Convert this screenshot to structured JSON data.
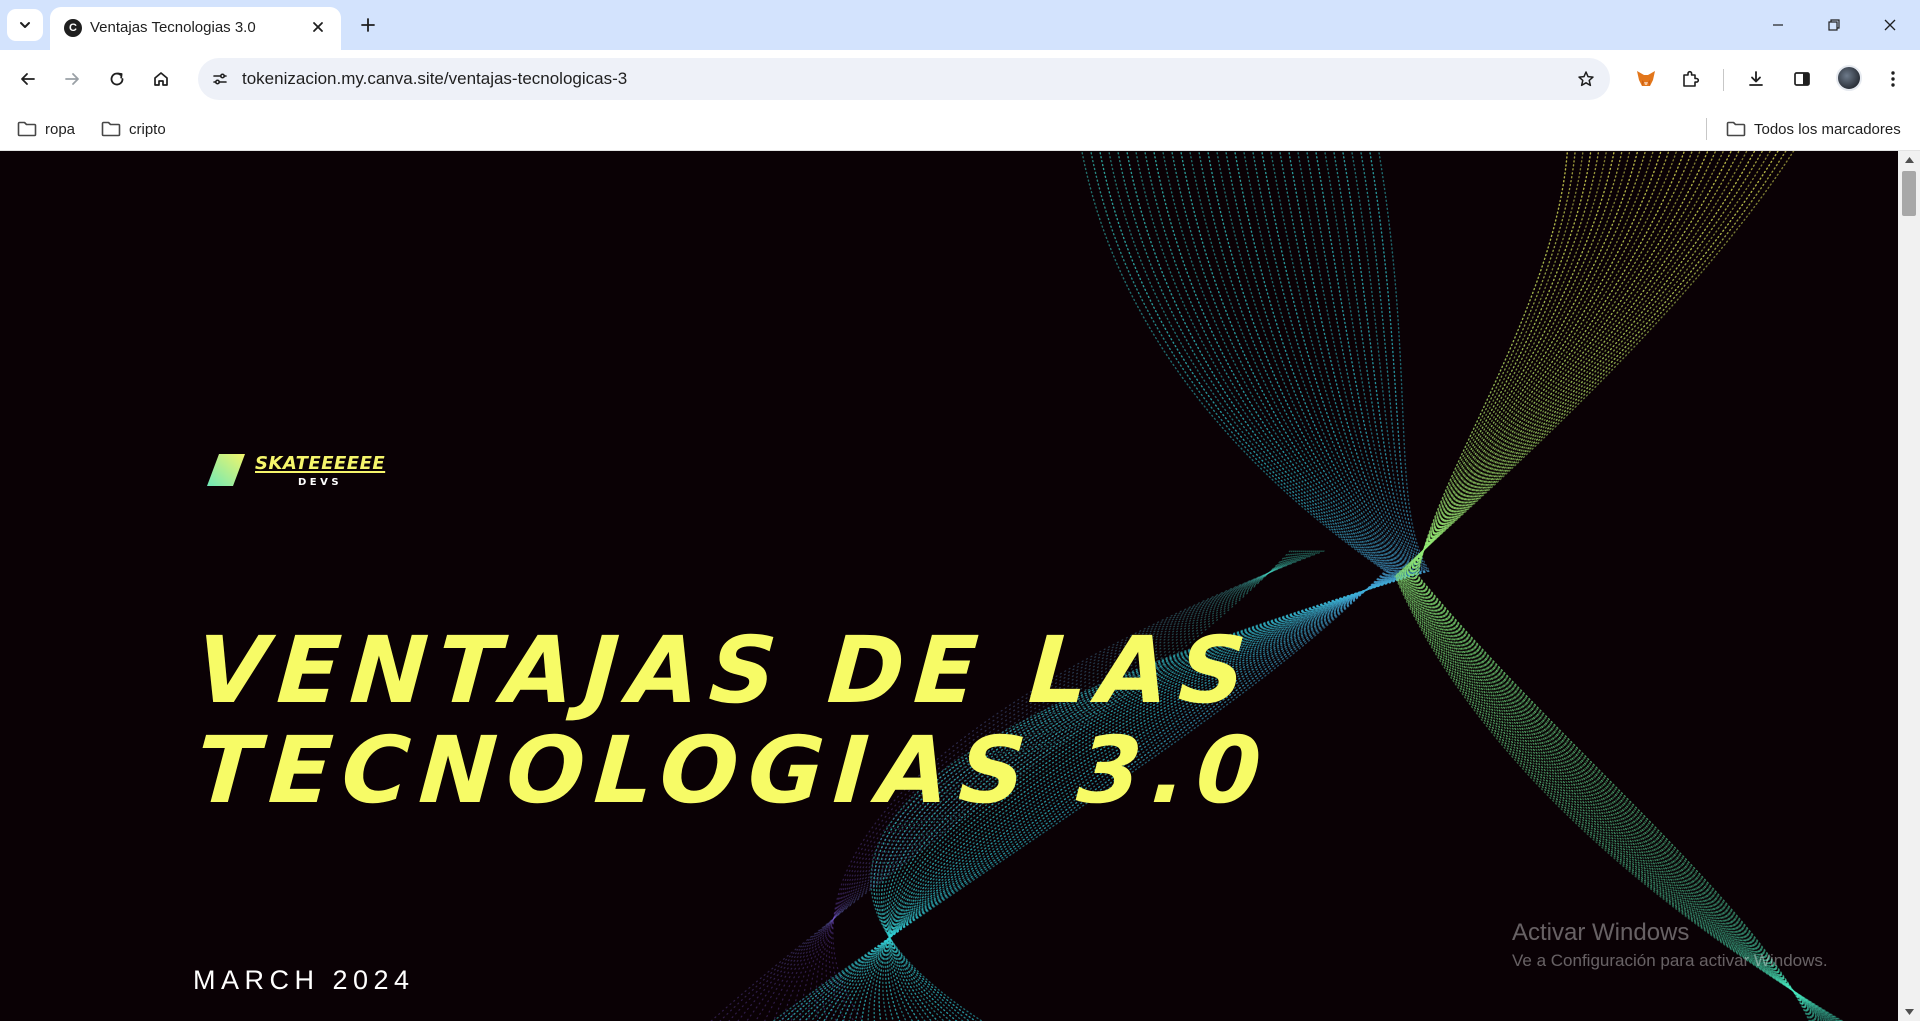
{
  "browser": {
    "tab": {
      "title": "Ventajas Tecnologias 3.0",
      "favicon_letter": "C"
    },
    "address": {
      "url": "tokenizacion.my.canva.site/ventajas-tecnologicas-3"
    },
    "bookmarks": [
      {
        "label": "ropa",
        "icon": "folder-icon"
      },
      {
        "label": "cripto",
        "icon": "folder-icon"
      }
    ],
    "all_bookmarks_label": "Todos los marcadores"
  },
  "page": {
    "logo": {
      "wordmark": "SKATEEEEEE",
      "subtitle": "DEVS"
    },
    "headline": {
      "line1": "VENTAJAS DE LAS",
      "line2": "TECNOLOGIAS 3.0"
    },
    "date": "MARCH 2024",
    "watermark": {
      "title": "Activar Windows",
      "subtitle": "Ve a Configuración para activar Windows."
    }
  },
  "colors": {
    "tabstrip": "#d3e3fd",
    "page_background": "#0a0105",
    "headline": "#f7fb66",
    "wave_teal": "#3ee6c4",
    "wave_yellow": "#f6f25a"
  }
}
